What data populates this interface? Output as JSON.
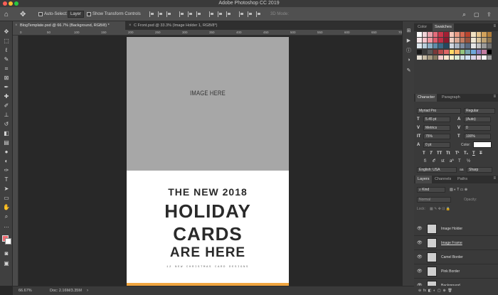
{
  "app": {
    "title": "Adobe Photoshop CC 2019"
  },
  "options_bar": {
    "auto_select_label": "Auto-Select:",
    "auto_select_value": "Layer",
    "transform_label": "Show Transform Controls",
    "mode_3d": "3D Mode:"
  },
  "tabs": [
    {
      "label": "BlogTemplate.psd @ 66.7% (Background, RGB/8) *",
      "active": true
    },
    {
      "label": "C Front.psd @ 33.3% (Image Holder 1, RGB/8*)",
      "active": false
    }
  ],
  "ruler": {
    "ticks": [
      "0",
      "50",
      "100",
      "150",
      "200",
      "250",
      "300",
      "350",
      "400",
      "450",
      "500",
      "550",
      "600",
      "650",
      "700"
    ]
  },
  "document": {
    "image_placeholder": "IMAGE HERE",
    "line1": "THE NEW 2018",
    "line2": "HOLIDAY",
    "line3": "CARDS",
    "line4": "ARE HERE",
    "subline": "12 NEW CHRISTMAS CARD DESIGNS",
    "colors": {
      "placeholder": "#a7a7a7",
      "accent_bar": "#f0a540",
      "text": "#2a2a2a"
    }
  },
  "status": {
    "zoom": "66.67%",
    "doc_size": "Doc: 2.16M/3.35M"
  },
  "color_panel": {
    "tab_color": "Color",
    "tab_swatches": "Swatches"
  },
  "character_panel": {
    "tab_character": "Character",
    "tab_paragraph": "Paragraph",
    "font_family": "Myriad Pro",
    "font_style": "Regular",
    "font_size": "5.45 pt",
    "leading": "(Auto)",
    "kerning": "Metrics",
    "tracking": "0",
    "vertical_scale": "75%",
    "horizontal_scale": "100%",
    "baseline_shift": "0 pt",
    "color_label": "Color:",
    "language": "English: USA",
    "antialias": "Sharp"
  },
  "layers_panel": {
    "tab_layers": "Layers",
    "tab_channels": "Channels",
    "tab_paths": "Paths",
    "filter_kind": "Kind",
    "blend_mode": "Normal",
    "opacity_label": "Opacity:",
    "lock_label": "Lock:",
    "layers": [
      {
        "name": "Image Holder"
      },
      {
        "name": "Image Frame"
      },
      {
        "name": "Camel Border"
      },
      {
        "name": "Pink Border"
      },
      {
        "name": "Background"
      }
    ]
  }
}
